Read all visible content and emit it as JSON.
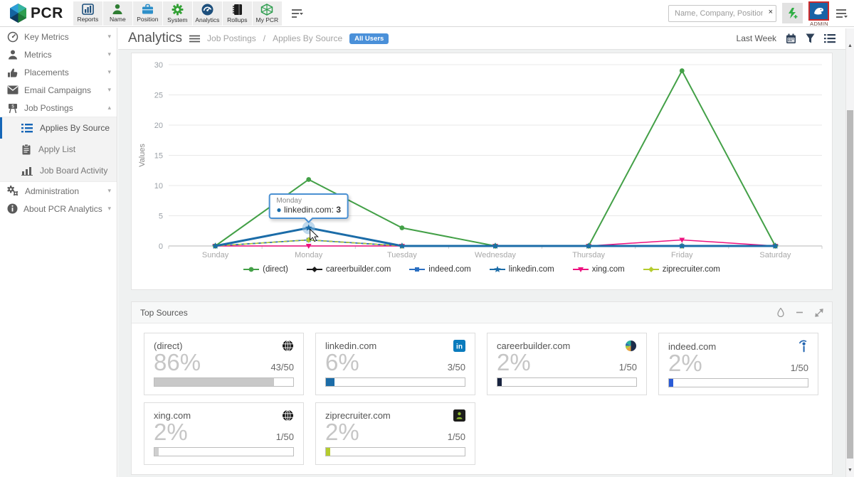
{
  "navbar": {
    "logo_text": "PCR",
    "toolbar": [
      {
        "label": "Reports",
        "icon": "bar-chart-icon"
      },
      {
        "label": "Name",
        "icon": "person-icon"
      },
      {
        "label": "Position",
        "icon": "briefcase-icon"
      },
      {
        "label": "System",
        "icon": "gear-icon"
      },
      {
        "label": "Analytics",
        "icon": "gauge-icon"
      },
      {
        "label": "Rollups",
        "icon": "book-icon"
      },
      {
        "label": "My PCR",
        "icon": "hexagon-icon"
      }
    ],
    "search": {
      "placeholder": "Name, Company, Position",
      "clear_label": "×"
    },
    "admin_label": "ADMIN"
  },
  "sidebar": {
    "items": [
      {
        "label": "Key Metrics",
        "icon": "gauge-icon"
      },
      {
        "label": "Metrics",
        "icon": "person-icon"
      },
      {
        "label": "Placements",
        "icon": "thumbs-up-icon"
      },
      {
        "label": "Email Campaigns",
        "icon": "envelope-icon"
      },
      {
        "label": "Job Postings",
        "icon": "signpost-icon",
        "expanded": true
      },
      {
        "label": "Administration",
        "icon": "gears-icon"
      },
      {
        "label": "About PCR Analytics",
        "icon": "info-icon"
      }
    ],
    "sub_items": [
      {
        "label": "Applies By Source",
        "icon": "list-icon",
        "active": true
      },
      {
        "label": "Apply List",
        "icon": "clipboard-icon",
        "active": false
      },
      {
        "label": "Job Board Activity",
        "icon": "bar-chart-icon",
        "active": false
      }
    ]
  },
  "header": {
    "title": "Analytics",
    "breadcrumb_section": "Job Postings",
    "breadcrumb_separator": "/",
    "breadcrumb_page": "Applies By Source",
    "badge": "All Users",
    "range_label": "Last Week"
  },
  "chart_data": {
    "type": "line",
    "title": "",
    "xlabel": "",
    "ylabel": "Values",
    "categories": [
      "Sunday",
      "Monday",
      "Tuesday",
      "Wednesday",
      "Thursday",
      "Friday",
      "Saturday"
    ],
    "ylim": [
      0,
      30
    ],
    "yticks": [
      0,
      5,
      10,
      15,
      20,
      25,
      30
    ],
    "grid": true,
    "legend_position": "bottom",
    "series": [
      {
        "name": "(direct)",
        "color": "#43a047",
        "marker": "circle",
        "width": 2,
        "values": [
          0,
          11,
          3,
          0,
          0,
          29,
          0
        ]
      },
      {
        "name": "careerbuilder.com",
        "color": "#1a1a1a",
        "marker": "diamond",
        "width": 1.5,
        "values": [
          0,
          1,
          0,
          0,
          0,
          0,
          0
        ]
      },
      {
        "name": "indeed.com",
        "color": "#2a6fc2",
        "marker": "square",
        "width": 1.5,
        "values": [
          0,
          1,
          0,
          0,
          0,
          0,
          0
        ]
      },
      {
        "name": "linkedin.com",
        "color": "#1b6ca8",
        "marker": "star",
        "width": 3,
        "values": [
          0,
          3,
          0,
          0,
          0,
          0,
          0
        ]
      },
      {
        "name": "xing.com",
        "color": "#ed117f",
        "marker": "triangle-down",
        "width": 1.5,
        "values": [
          0,
          0,
          0,
          0,
          0,
          1,
          0
        ]
      },
      {
        "name": "ziprecruiter.com",
        "color": "#b5cc2e",
        "marker": "diamond",
        "width": 1.5,
        "dash": "5 3",
        "values": [
          0,
          1,
          0,
          0,
          0,
          0,
          0
        ]
      }
    ]
  },
  "tooltip": {
    "day": "Monday",
    "series": "linkedin.com",
    "series_label": "linkedin.com:",
    "value": "3"
  },
  "top_sources": {
    "title": "Top Sources",
    "cards": [
      {
        "name": "(direct)",
        "icon": "globe-icon",
        "percent": "86%",
        "fraction": "43/50",
        "fill_pct": 86,
        "bar_color": "#c8c8c8"
      },
      {
        "name": "linkedin.com",
        "icon": "linkedin-icon",
        "percent": "6%",
        "fraction": "3/50",
        "fill_pct": 6,
        "bar_color": "#1b6ca8"
      },
      {
        "name": "careerbuilder.com",
        "icon": "careerbuilder-icon",
        "percent": "2%",
        "fraction": "1/50",
        "fill_pct": 3,
        "bar_color": "#18233f"
      },
      {
        "name": "indeed.com",
        "icon": "indeed-icon",
        "percent": "2%",
        "fraction": "1/50",
        "fill_pct": 3,
        "bar_color": "#2a5bd7"
      },
      {
        "name": "xing.com",
        "icon": "globe-icon",
        "percent": "2%",
        "fraction": "1/50",
        "fill_pct": 3,
        "bar_color": "#cfcfcf"
      },
      {
        "name": "ziprecruiter.com",
        "icon": "ziprecruiter-icon",
        "percent": "2%",
        "fraction": "1/50",
        "fill_pct": 3,
        "bar_color": "#b5cc2e"
      }
    ]
  },
  "colors": {
    "accent_blue": "#4a90d9",
    "active_item": "#1566b7",
    "tooltip_border": "#4a90d2"
  }
}
